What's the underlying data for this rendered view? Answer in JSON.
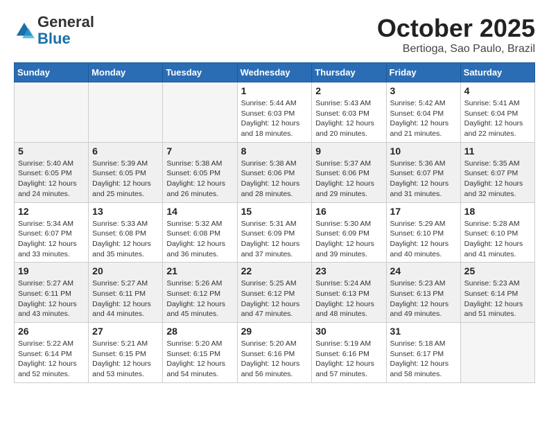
{
  "header": {
    "logo_line1": "General",
    "logo_line2": "Blue",
    "month": "October 2025",
    "location": "Bertioga, Sao Paulo, Brazil"
  },
  "weekdays": [
    "Sunday",
    "Monday",
    "Tuesday",
    "Wednesday",
    "Thursday",
    "Friday",
    "Saturday"
  ],
  "weeks": [
    [
      {
        "day": "",
        "info": ""
      },
      {
        "day": "",
        "info": ""
      },
      {
        "day": "",
        "info": ""
      },
      {
        "day": "1",
        "info": "Sunrise: 5:44 AM\nSunset: 6:03 PM\nDaylight: 12 hours\nand 18 minutes."
      },
      {
        "day": "2",
        "info": "Sunrise: 5:43 AM\nSunset: 6:03 PM\nDaylight: 12 hours\nand 20 minutes."
      },
      {
        "day": "3",
        "info": "Sunrise: 5:42 AM\nSunset: 6:04 PM\nDaylight: 12 hours\nand 21 minutes."
      },
      {
        "day": "4",
        "info": "Sunrise: 5:41 AM\nSunset: 6:04 PM\nDaylight: 12 hours\nand 22 minutes."
      }
    ],
    [
      {
        "day": "5",
        "info": "Sunrise: 5:40 AM\nSunset: 6:05 PM\nDaylight: 12 hours\nand 24 minutes."
      },
      {
        "day": "6",
        "info": "Sunrise: 5:39 AM\nSunset: 6:05 PM\nDaylight: 12 hours\nand 25 minutes."
      },
      {
        "day": "7",
        "info": "Sunrise: 5:38 AM\nSunset: 6:05 PM\nDaylight: 12 hours\nand 26 minutes."
      },
      {
        "day": "8",
        "info": "Sunrise: 5:38 AM\nSunset: 6:06 PM\nDaylight: 12 hours\nand 28 minutes."
      },
      {
        "day": "9",
        "info": "Sunrise: 5:37 AM\nSunset: 6:06 PM\nDaylight: 12 hours\nand 29 minutes."
      },
      {
        "day": "10",
        "info": "Sunrise: 5:36 AM\nSunset: 6:07 PM\nDaylight: 12 hours\nand 31 minutes."
      },
      {
        "day": "11",
        "info": "Sunrise: 5:35 AM\nSunset: 6:07 PM\nDaylight: 12 hours\nand 32 minutes."
      }
    ],
    [
      {
        "day": "12",
        "info": "Sunrise: 5:34 AM\nSunset: 6:07 PM\nDaylight: 12 hours\nand 33 minutes."
      },
      {
        "day": "13",
        "info": "Sunrise: 5:33 AM\nSunset: 6:08 PM\nDaylight: 12 hours\nand 35 minutes."
      },
      {
        "day": "14",
        "info": "Sunrise: 5:32 AM\nSunset: 6:08 PM\nDaylight: 12 hours\nand 36 minutes."
      },
      {
        "day": "15",
        "info": "Sunrise: 5:31 AM\nSunset: 6:09 PM\nDaylight: 12 hours\nand 37 minutes."
      },
      {
        "day": "16",
        "info": "Sunrise: 5:30 AM\nSunset: 6:09 PM\nDaylight: 12 hours\nand 39 minutes."
      },
      {
        "day": "17",
        "info": "Sunrise: 5:29 AM\nSunset: 6:10 PM\nDaylight: 12 hours\nand 40 minutes."
      },
      {
        "day": "18",
        "info": "Sunrise: 5:28 AM\nSunset: 6:10 PM\nDaylight: 12 hours\nand 41 minutes."
      }
    ],
    [
      {
        "day": "19",
        "info": "Sunrise: 5:27 AM\nSunset: 6:11 PM\nDaylight: 12 hours\nand 43 minutes."
      },
      {
        "day": "20",
        "info": "Sunrise: 5:27 AM\nSunset: 6:11 PM\nDaylight: 12 hours\nand 44 minutes."
      },
      {
        "day": "21",
        "info": "Sunrise: 5:26 AM\nSunset: 6:12 PM\nDaylight: 12 hours\nand 45 minutes."
      },
      {
        "day": "22",
        "info": "Sunrise: 5:25 AM\nSunset: 6:12 PM\nDaylight: 12 hours\nand 47 minutes."
      },
      {
        "day": "23",
        "info": "Sunrise: 5:24 AM\nSunset: 6:13 PM\nDaylight: 12 hours\nand 48 minutes."
      },
      {
        "day": "24",
        "info": "Sunrise: 5:23 AM\nSunset: 6:13 PM\nDaylight: 12 hours\nand 49 minutes."
      },
      {
        "day": "25",
        "info": "Sunrise: 5:23 AM\nSunset: 6:14 PM\nDaylight: 12 hours\nand 51 minutes."
      }
    ],
    [
      {
        "day": "26",
        "info": "Sunrise: 5:22 AM\nSunset: 6:14 PM\nDaylight: 12 hours\nand 52 minutes."
      },
      {
        "day": "27",
        "info": "Sunrise: 5:21 AM\nSunset: 6:15 PM\nDaylight: 12 hours\nand 53 minutes."
      },
      {
        "day": "28",
        "info": "Sunrise: 5:20 AM\nSunset: 6:15 PM\nDaylight: 12 hours\nand 54 minutes."
      },
      {
        "day": "29",
        "info": "Sunrise: 5:20 AM\nSunset: 6:16 PM\nDaylight: 12 hours\nand 56 minutes."
      },
      {
        "day": "30",
        "info": "Sunrise: 5:19 AM\nSunset: 6:16 PM\nDaylight: 12 hours\nand 57 minutes."
      },
      {
        "day": "31",
        "info": "Sunrise: 5:18 AM\nSunset: 6:17 PM\nDaylight: 12 hours\nand 58 minutes."
      },
      {
        "day": "",
        "info": ""
      }
    ]
  ]
}
